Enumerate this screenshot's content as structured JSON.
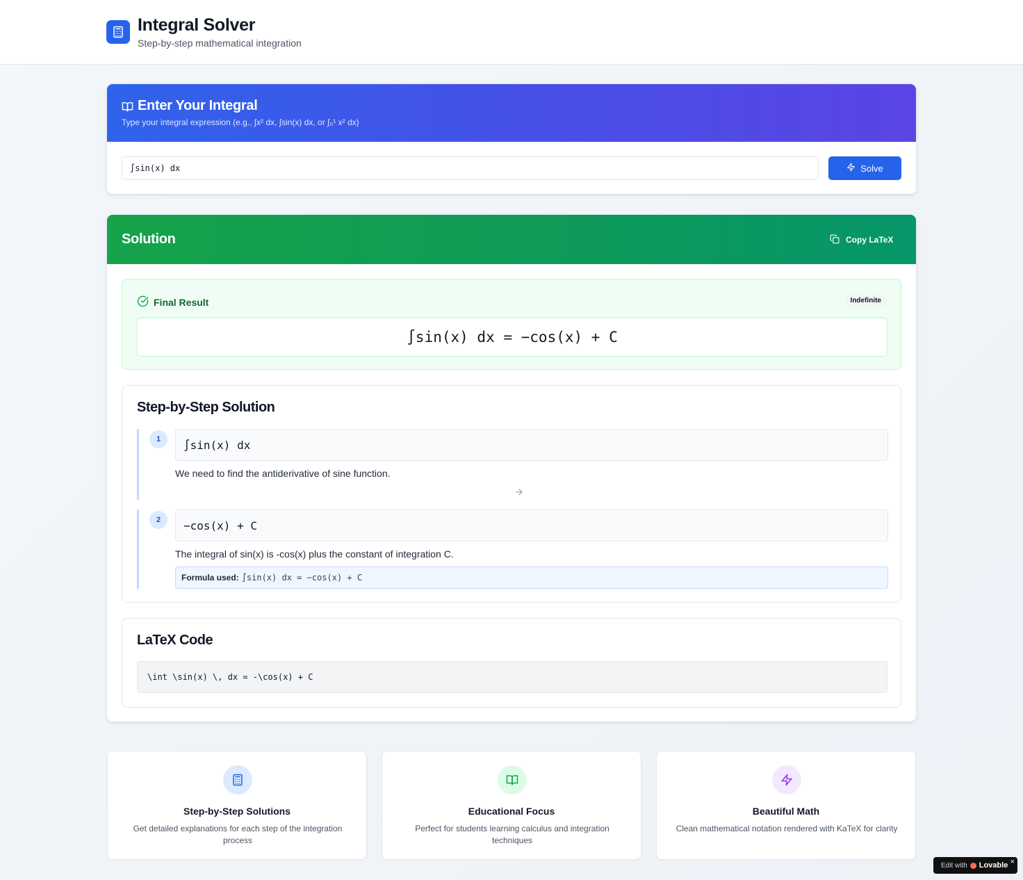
{
  "header": {
    "title": "Integral Solver",
    "subtitle": "Step-by-step mathematical integration"
  },
  "input_card": {
    "title": "Enter Your Integral",
    "description": "Type your integral expression (e.g., ∫x² dx, ∫sin(x) dx, or ∫₀¹ x² dx)",
    "input_value": "∫sin(x) dx",
    "solve_label": "Solve"
  },
  "solution": {
    "title": "Solution",
    "copy_label": "Copy LaTeX",
    "final_label": "Final Result",
    "badge": "Indefinite",
    "final_expression": "∫sin(x) dx = −cos(x) + C",
    "steps_title": "Step-by-Step Solution",
    "steps": [
      {
        "number": "1",
        "expression": "∫sin(x) dx",
        "description": "We need to find the antiderivative of sine function."
      },
      {
        "number": "2",
        "expression": "−cos(x) + C",
        "description": "The integral of sin(x) is -cos(x) plus the constant of integration C.",
        "formula_label": "Formula used:",
        "formula": "∫sin(x) dx = −cos(x) + C"
      }
    ],
    "latex_title": "LaTeX Code",
    "latex_code": "\\int \\sin(x) \\, dx = -\\cos(x) + C"
  },
  "features": [
    {
      "title": "Step-by-Step Solutions",
      "description": "Get detailed explanations for each step of the integration process",
      "icon": "calculator-icon"
    },
    {
      "title": "Educational Focus",
      "description": "Perfect for students learning calculus and integration techniques",
      "icon": "book-icon"
    },
    {
      "title": "Beautiful Math",
      "description": "Clean mathematical notation rendered with KaTeX for clarity",
      "icon": "zap-icon"
    }
  ],
  "badge": {
    "prefix": "Edit with",
    "brand": "Lovable"
  },
  "colors": {
    "primary": "#2563eb",
    "success": "#16a34a",
    "purple": "#9333ea"
  }
}
